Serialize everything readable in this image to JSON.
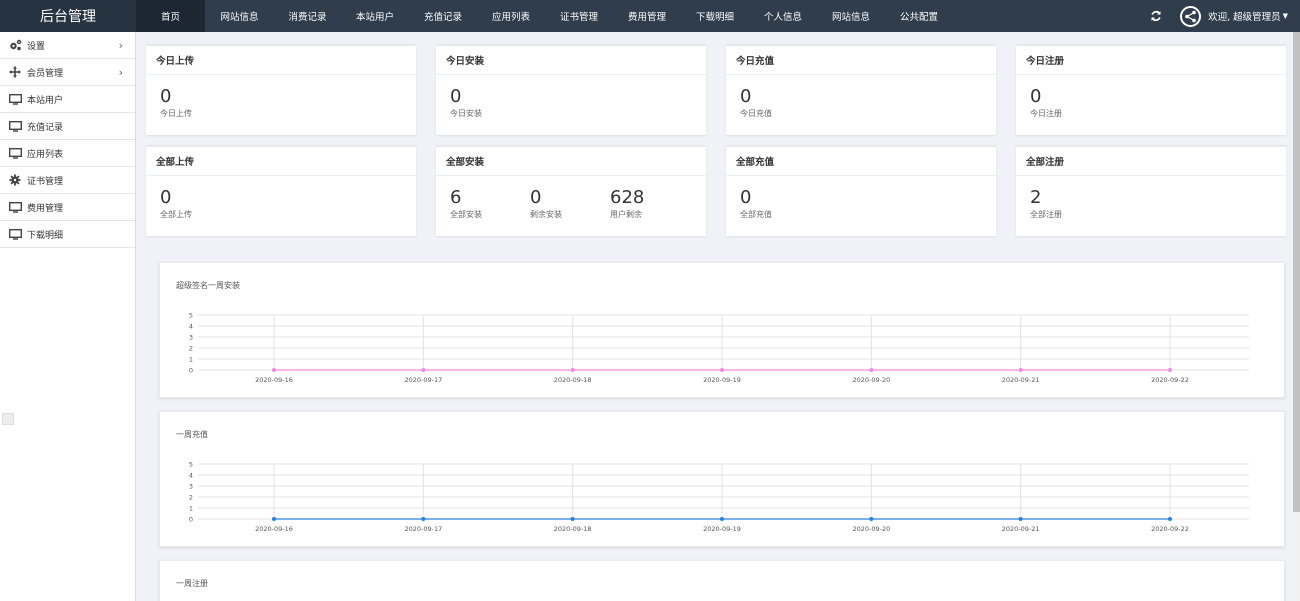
{
  "brand": "后台管理",
  "nav": [
    {
      "label": "首页",
      "active": true
    },
    {
      "label": "网站信息"
    },
    {
      "label": "消费记录"
    },
    {
      "label": "本站用户"
    },
    {
      "label": "充值记录"
    },
    {
      "label": "应用列表"
    },
    {
      "label": "证书管理"
    },
    {
      "label": "费用管理"
    },
    {
      "label": "下载明细"
    },
    {
      "label": "个人信息"
    },
    {
      "label": "网站信息"
    },
    {
      "label": "公共配置"
    }
  ],
  "user": {
    "label": "欢迎, 超级管理员"
  },
  "sidebar": {
    "items": [
      {
        "label": "设置",
        "icon": "gears-icon",
        "arrow": true
      },
      {
        "label": "会员管理",
        "icon": "move-icon",
        "arrow": true
      },
      {
        "label": "本站用户",
        "icon": "monitor-icon"
      },
      {
        "label": "充值记录",
        "icon": "monitor-icon"
      },
      {
        "label": "应用列表",
        "icon": "monitor-icon"
      },
      {
        "label": "证书管理",
        "icon": "gear-icon"
      },
      {
        "label": "费用管理",
        "icon": "monitor-icon"
      },
      {
        "label": "下载明细",
        "icon": "monitor-icon"
      }
    ]
  },
  "cards": [
    {
      "title": "今日上传",
      "stats": [
        {
          "value": "0",
          "label": "今日上传"
        }
      ]
    },
    {
      "title": "今日安装",
      "stats": [
        {
          "value": "0",
          "label": "今日安装"
        }
      ]
    },
    {
      "title": "今日充值",
      "stats": [
        {
          "value": "0",
          "label": "今日充值"
        }
      ]
    },
    {
      "title": "今日注册",
      "stats": [
        {
          "value": "0",
          "label": "今日注册"
        }
      ]
    },
    {
      "title": "全部上传",
      "stats": [
        {
          "value": "0",
          "label": "全部上传"
        }
      ]
    },
    {
      "title": "全部安装",
      "stats": [
        {
          "value": "6",
          "label": "全部安装"
        },
        {
          "value": "0",
          "label": "剩余安装"
        },
        {
          "value": "628",
          "label": "用户剩余"
        }
      ]
    },
    {
      "title": "全部充值",
      "stats": [
        {
          "value": "0",
          "label": "全部充值"
        }
      ]
    },
    {
      "title": "全部注册",
      "stats": [
        {
          "value": "2",
          "label": "全部注册"
        }
      ]
    }
  ],
  "chart_data": [
    {
      "type": "line",
      "title": "超级签名一周安装",
      "x": [
        "2020-09-16",
        "2020-09-17",
        "2020-09-18",
        "2020-09-19",
        "2020-09-20",
        "2020-09-21",
        "2020-09-22"
      ],
      "series": [
        {
          "values": [
            0,
            0,
            0,
            0,
            0,
            0,
            0
          ],
          "color": "#f08ce0"
        }
      ],
      "ylim": [
        0,
        5
      ],
      "yticks": [
        0,
        1,
        2,
        3,
        4,
        5
      ],
      "grid": true
    },
    {
      "type": "line",
      "title": "一周充值",
      "x": [
        "2020-09-16",
        "2020-09-17",
        "2020-09-18",
        "2020-09-19",
        "2020-09-20",
        "2020-09-21",
        "2020-09-22"
      ],
      "series": [
        {
          "values": [
            0,
            0,
            0,
            0,
            0,
            0,
            0
          ],
          "color": "#2b7fd9"
        }
      ],
      "ylim": [
        0,
        5
      ],
      "yticks": [
        0,
        1,
        2,
        3,
        4,
        5
      ],
      "grid": true
    },
    {
      "type": "line",
      "title": "一周注册"
    }
  ]
}
